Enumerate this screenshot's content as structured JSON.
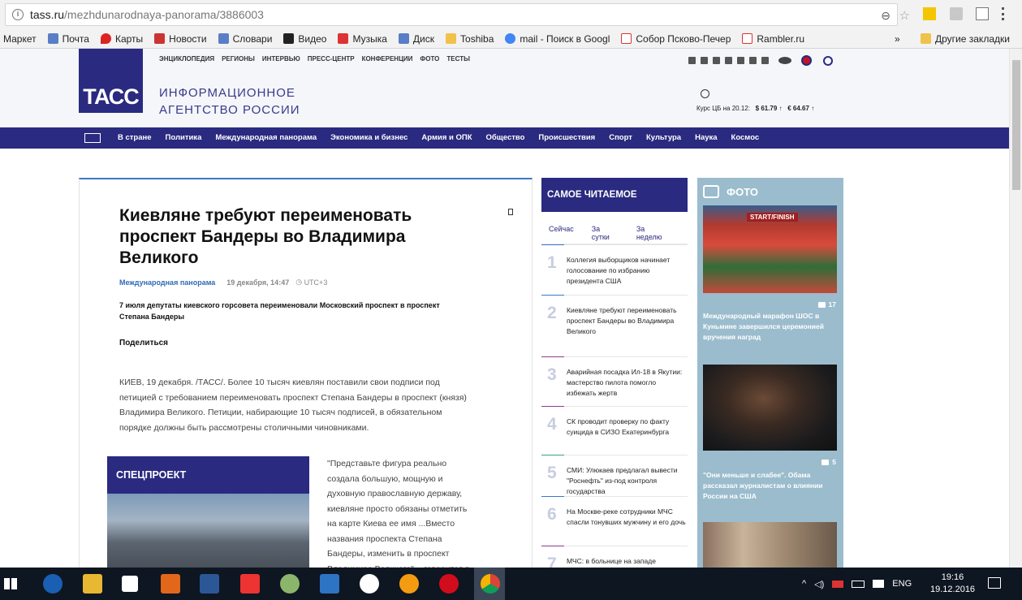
{
  "browser": {
    "url_host": "tass.ru",
    "url_path": "/mezhdunarodnaya-panorama/3886003",
    "bookmarks": [
      "Маркет",
      "Почта",
      "Карты",
      "Новости",
      "Словари",
      "Видео",
      "Музыка",
      "Диск",
      "Toshiba",
      "mail - Поиск в Googl",
      "Собор Псково-Печер",
      "Rambler.ru"
    ],
    "more": "»",
    "other_bookmarks": "Другие закладки"
  },
  "site": {
    "logo": "ТАСС",
    "tagline_line1": "ИНФОРМАЦИОННОЕ",
    "tagline_line2": "АГЕНТСТВО РОССИИ",
    "topnav": [
      "ЭНЦИКЛОПЕДИЯ",
      "РЕГИОНЫ",
      "ИНТЕРВЬЮ",
      "ПРЕСС-ЦЕНТР",
      "КОНФЕРЕНЦИИ",
      "ФОТО",
      "ТЕСТЫ"
    ],
    "rates_label": "Курс ЦБ на 20.12:",
    "usd": "$ 61.79",
    "eur": "€ 64.67",
    "arrow": "↑",
    "mainnav": [
      "В стране",
      "Политика",
      "Международная панорама",
      "Экономика и бизнес",
      "Армия и ОПК",
      "Общество",
      "Происшествия",
      "Спорт",
      "Культура",
      "Наука",
      "Космос"
    ]
  },
  "article": {
    "headline": "Киевляне требуют переименовать проспект Бандеры во Владимира Великого",
    "rubric": "Международная панорама",
    "date": "19 декабря, 14:47",
    "tz": "UTC+3",
    "lead": "7 июля депутаты киевского горсовета переименовали Московский проспект в проспект Степана Бандеры",
    "share": "Поделиться",
    "body": "КИЕВ, 19 декабря. /ТАСС/. Более 10 тысяч киевлян поставили свои подписи под петицией с требованием переименовать проспект Степана Бандеры в проспект (князя) Владимира Великого. Петиции, набирающие 10 тысяч подписей, в обязательном порядке должны быть рассмотрены столичными чиновниками.",
    "special_title": "СПЕЦПРОЕКТ",
    "quote": "\"Представьте фигура реально создала большую, мощную и духовную православную державу, киевляне просто обязаны отметить на карте Киева ее имя ...Вместо названия проспекта Степана Бандеры, изменить в проспект Владимира Великого\", - говорится в"
  },
  "mostread": {
    "title": "САМОЕ ЧИТАЕМОЕ",
    "tabs": [
      "Сейчас",
      "За сутки",
      "За неделю"
    ],
    "items": [
      {
        "num": "1",
        "text": "Коллегия выборщиков начинает голосование по избранию президента США",
        "color": "#3a78c9"
      },
      {
        "num": "2",
        "text": "Киевляне требуют переименовать проспект Бандеры во Владимира Великого",
        "color": "#3a78c9"
      },
      {
        "num": "3",
        "text": "Аварийная посадка Ил-18 в Якутии: мастерство пилота помогло избежать жертв",
        "color": "#8e3c8f"
      },
      {
        "num": "4",
        "text": "СК проводит проверку по факту суицида в СИЗО Екатеринбурга",
        "color": "#8e3c8f"
      },
      {
        "num": "5",
        "text": "СМИ: Улюкаев предлагал вывести \"Роснефть\" из-под контроля государства",
        "color": "#3aa27b"
      },
      {
        "num": "6",
        "text": "На Москве-реке сотрудники МЧС спасли тонувших мужчину и его дочь",
        "color": "#3a78c9"
      },
      {
        "num": "7",
        "text": "МЧС: в больнице на западе",
        "color": "#8e3c8f"
      }
    ]
  },
  "photo": {
    "title": "ФОТО",
    "items": [
      {
        "count": "17",
        "caption": "Международный марафон ШОС в Куньмине завершился церемонией вручения наград",
        "banner": "START/FINISH"
      },
      {
        "count": "5",
        "caption": "\"Они меньше и слабее\". Обама рассказал журналистам о влиянии России на США"
      }
    ]
  },
  "taskbar": {
    "lang": "ENG",
    "time": "19:16",
    "date": "19.12.2016"
  }
}
